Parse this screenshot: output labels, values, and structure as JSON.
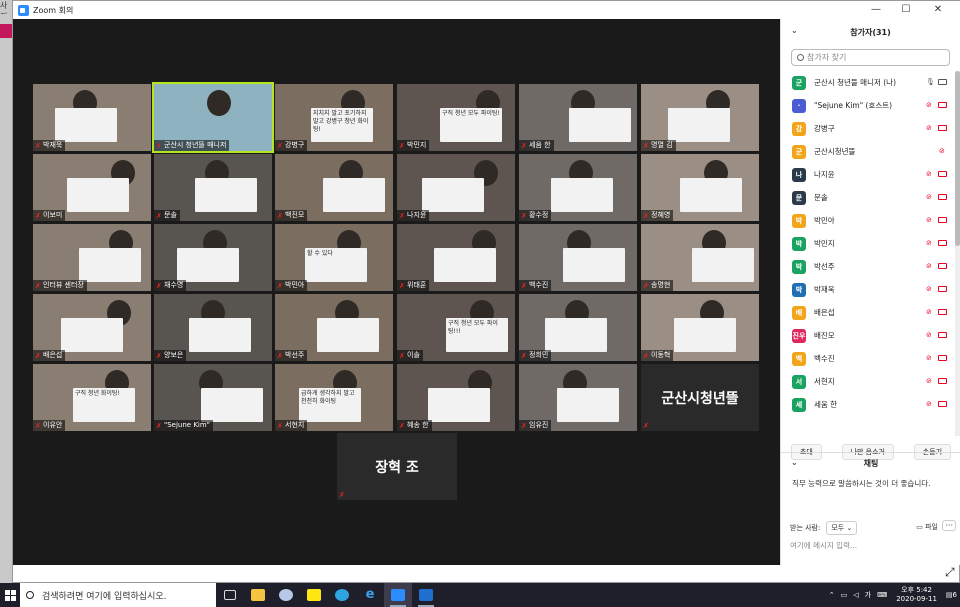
{
  "desktop": {
    "left_tag": "사진"
  },
  "window": {
    "title": "Zoom 회의"
  },
  "gallery": {
    "tiles": [
      {
        "name": "박재욱"
      },
      {
        "name": "군산시 청년뜰 매니저",
        "active": true
      },
      {
        "name": "강병구",
        "sign": "지치지 말고 포기하지 말고 강병구 청년 화이팅!"
      },
      {
        "name": "박민지",
        "sign": "구직 청년 모두 파이팅!"
      },
      {
        "name": "세움 한"
      },
      {
        "name": "명열 김"
      },
      {
        "name": "이보미"
      },
      {
        "name": "문솔"
      },
      {
        "name": "백진모"
      },
      {
        "name": "나지윤"
      },
      {
        "name": "황수정"
      },
      {
        "name": "정혜영"
      },
      {
        "name": "인터뷰 센터장"
      },
      {
        "name": "채수영"
      },
      {
        "name": "박민아",
        "sign": "할 수 있다"
      },
      {
        "name": "위태훈"
      },
      {
        "name": "백수진"
      },
      {
        "name": "송명현"
      },
      {
        "name": "배은섭"
      },
      {
        "name": "양보은"
      },
      {
        "name": "박선주"
      },
      {
        "name": "이솔",
        "sign": "구직 청년 모두 파이팅!!!"
      },
      {
        "name": "정희민"
      },
      {
        "name": "이동혁"
      },
      {
        "name": "이유안",
        "sign": "구직 청년 화이팅!"
      },
      {
        "name": "\"Sejune Kim\""
      },
      {
        "name": "서현지",
        "sign": "급하게 생각하지 말고 천천히 화이팅"
      },
      {
        "name": "혜송 한"
      },
      {
        "name": "임유진"
      },
      {
        "name": "군산시청년뜰",
        "name_only": true
      }
    ],
    "bottom_tile": {
      "name": "장혁 조"
    }
  },
  "participants": {
    "header": "참가자(31)",
    "search_placeholder": "참가자 찾기",
    "list": [
      {
        "avatar": "군",
        "color": "#1aa260",
        "name": "군산시 청년뜰 매니저 (나)",
        "mic_on": true,
        "cam_on": true
      },
      {
        "avatar": "·",
        "color": "#4a5bd4",
        "name": "\"Sejune Kim\" (호스트)",
        "mic_on": false,
        "cam_on": false
      },
      {
        "avatar": "강",
        "color": "#f2a51a",
        "name": "강병구",
        "mic_on": false,
        "cam_on": true
      },
      {
        "avatar": "군",
        "color": "#f2a51a",
        "name": "군산시청년뜰",
        "mic_on": false,
        "cam_on": null
      },
      {
        "avatar": "나",
        "color": "#2b3a4a",
        "name": "나지윤",
        "mic_on": false,
        "cam_on": true
      },
      {
        "avatar": "문",
        "color": "#2b3a4a",
        "name": "문솔",
        "mic_on": false,
        "cam_on": true
      },
      {
        "avatar": "박",
        "color": "#f2a51a",
        "name": "박민아",
        "mic_on": false,
        "cam_on": true
      },
      {
        "avatar": "박",
        "color": "#1aa260",
        "name": "박민지",
        "mic_on": false,
        "cam_on": true
      },
      {
        "avatar": "박",
        "color": "#1aa260",
        "name": "박선주",
        "mic_on": false,
        "cam_on": true
      },
      {
        "avatar": "박",
        "color": "#1f6fb5",
        "name": "박재욱",
        "mic_on": false,
        "cam_on": true
      },
      {
        "avatar": "배",
        "color": "#f2a51a",
        "name": "배은섭",
        "mic_on": false,
        "cam_on": true
      },
      {
        "avatar": "진우",
        "color": "#e0245e",
        "name": "배진모",
        "mic_on": false,
        "cam_on": true
      },
      {
        "avatar": "백",
        "color": "#f2a51a",
        "name": "백수진",
        "mic_on": false,
        "cam_on": true
      },
      {
        "avatar": "서",
        "color": "#1aa260",
        "name": "서현지",
        "mic_on": false,
        "cam_on": true
      },
      {
        "avatar": "세",
        "color": "#1aa260",
        "name": "세움 한",
        "mic_on": false,
        "cam_on": true
      }
    ],
    "buttons": [
      "초대",
      "나만 음소거",
      "손들기"
    ]
  },
  "chat": {
    "header": "채팅",
    "message": "직무 능력으로 말씀하시는 것이 더 좋습니다.",
    "to_label": "받는 사람:",
    "to_value": "모두",
    "file_label": "파일",
    "more_label": "···",
    "input_placeholder": "여기에 메시지 입력..."
  },
  "taskbar": {
    "search_placeholder": "검색하려면 여기에 입력하십시오.",
    "time": "오후 5:42",
    "date": "2020-09-11",
    "ime": "가",
    "notifications": "6"
  }
}
